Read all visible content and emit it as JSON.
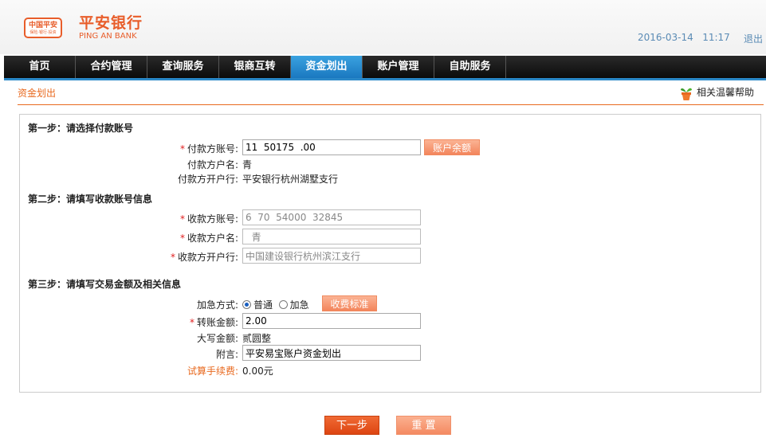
{
  "header": {
    "logo_cn": "中国平安",
    "logo_sub": "保险·银行·投资",
    "brand_cn": "平安银行",
    "brand_en": "PING AN BANK",
    "date": "2016-03-14",
    "time": "11:17",
    "logout": "退出"
  },
  "nav": {
    "items": [
      "首页",
      "合约管理",
      "查询服务",
      "银商互转",
      "资金划出",
      "账户管理",
      "自助服务"
    ],
    "active": "资金划出"
  },
  "breadcrumb": "资金划出",
  "help_label": "相关温馨帮助",
  "step1": {
    "title": "第一步：请选择付款账号",
    "payer_account_label": "付款方账号:",
    "payer_account_value": "11  50175  .00",
    "balance_button": "账户余额",
    "payer_name_label": "付款方户名:",
    "payer_name_value": "  青",
    "payer_bank_label": "付款方开户行:",
    "payer_bank_value": "平安银行杭州湖墅支行"
  },
  "step2": {
    "title": "第二步：请填写收款账号信息",
    "payee_account_label": "收款方账号:",
    "payee_account_value": "6  70  54000  32845",
    "payee_name_label": "收款方户名:",
    "payee_name_value": "  青",
    "payee_bank_label": "收款方开户行:",
    "payee_bank_value": "中国建设银行杭州滨江支行"
  },
  "step3": {
    "title": "第三步：请填写交易金额及相关信息",
    "urgency_label": "加急方式:",
    "urgency_options": [
      "普通",
      "加急"
    ],
    "urgency_selected": "普通",
    "fee_standard_button": "收费标准",
    "amount_label": "转账金额:",
    "amount_value": "2.00",
    "amount_upper_label": "大写金额:",
    "amount_upper_value": "贰圆整",
    "memo_label": "附言:",
    "memo_value": "平安易宝账户资金划出",
    "fee_label": "试算手续费:",
    "fee_value": "0.00元"
  },
  "actions": {
    "next": "下一步",
    "reset": "重 置"
  },
  "colors": {
    "accent": "#e8691f",
    "nav_active": "#2a88c8",
    "button_light": "#f3855c",
    "button_dark": "#e04a1a"
  }
}
